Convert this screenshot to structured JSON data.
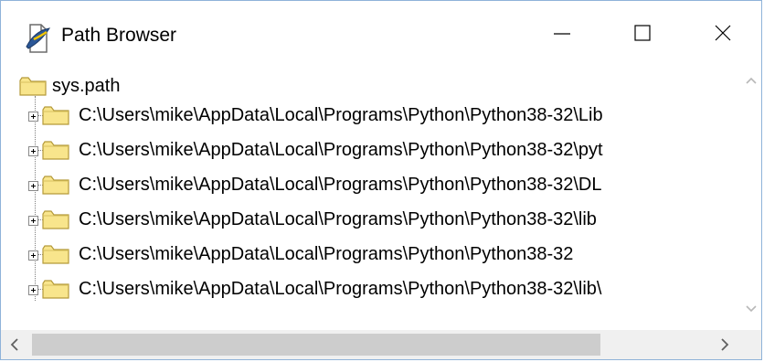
{
  "window": {
    "title": "Path Browser",
    "icon": "idle-feather-icon",
    "controls": [
      "minimize-icon",
      "maximize-icon",
      "close-icon"
    ]
  },
  "tree": {
    "root": {
      "label": "sys.path",
      "icon": "folder-icon",
      "expanded": true
    },
    "children": [
      {
        "label": "C:\\Users\\mike\\AppData\\Local\\Programs\\Python\\Python38-32\\Lib",
        "icon": "folder-icon",
        "expander": "plus"
      },
      {
        "label": "C:\\Users\\mike\\AppData\\Local\\Programs\\Python\\Python38-32\\pyt",
        "icon": "folder-icon",
        "expander": "plus"
      },
      {
        "label": "C:\\Users\\mike\\AppData\\Local\\Programs\\Python\\Python38-32\\DL",
        "icon": "folder-icon",
        "expander": "plus"
      },
      {
        "label": "C:\\Users\\mike\\AppData\\Local\\Programs\\Python\\Python38-32\\lib",
        "icon": "folder-icon",
        "expander": "plus"
      },
      {
        "label": "C:\\Users\\mike\\AppData\\Local\\Programs\\Python\\Python38-32",
        "icon": "folder-icon",
        "expander": "plus"
      },
      {
        "label": "C:\\Users\\mike\\AppData\\Local\\Programs\\Python\\Python38-32\\lib\\",
        "icon": "folder-icon",
        "expander": "plus"
      }
    ]
  },
  "colors": {
    "folder_fill": "#f8e58c",
    "folder_stroke": "#b59a3a",
    "window_border": "#8fb3d9",
    "scrollbar_track": "#f0f0f0",
    "scrollbar_thumb": "#cdcdcd"
  }
}
